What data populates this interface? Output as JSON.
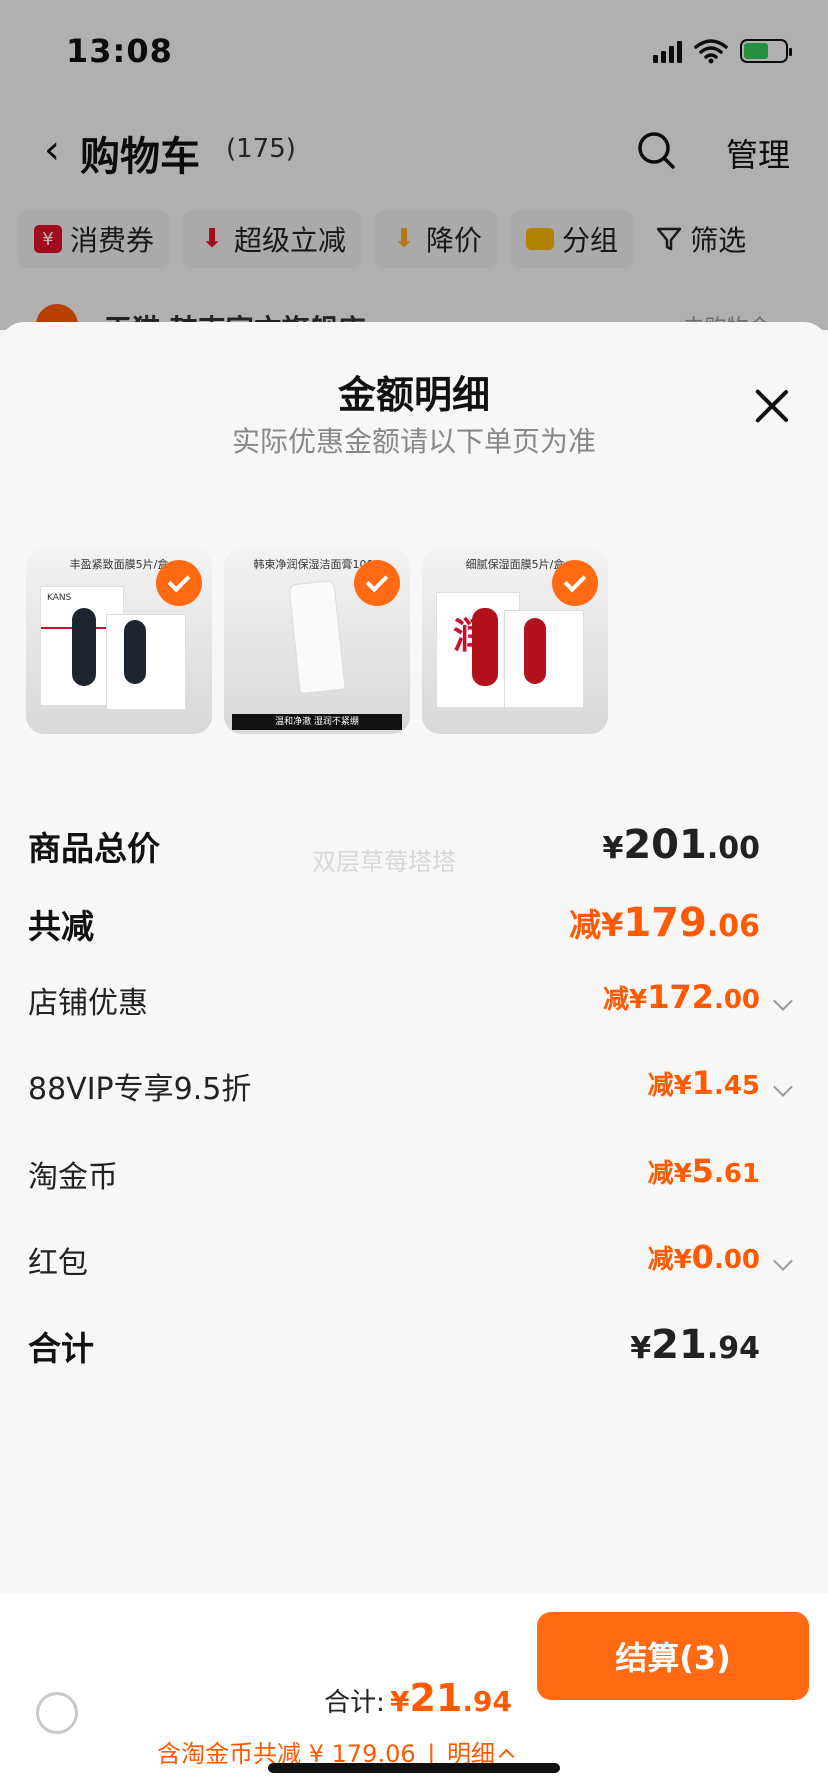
{
  "status_bar": {
    "time": "13:08"
  },
  "cart_header": {
    "title": "购物车",
    "count": "(175)",
    "manage": "管理"
  },
  "filters": [
    {
      "label": "消费券",
      "icon": "coupon-icon",
      "color": "#e0102a"
    },
    {
      "label": "超级立减",
      "icon": "arrow-down-icon",
      "color": "#e0102a"
    },
    {
      "label": "降价",
      "icon": "price-drop-icon",
      "color": "#f5a623"
    },
    {
      "label": "分组",
      "icon": "folder-icon",
      "color": "#f5b400"
    }
  ],
  "filter_plain": {
    "label": "筛选",
    "icon": "filter-icon"
  },
  "store_peek": {
    "name": "天猫 韩束官方旗舰店",
    "link": "去购物金 >"
  },
  "sheet": {
    "title": "金额明细",
    "subtitle": "实际优惠金额请以下单页为准",
    "watermark": "双层草莓塔塔"
  },
  "products": [
    {
      "caption": "丰盈紧致面膜5片/盒",
      "pkg_text": "KANS"
    },
    {
      "caption": "韩束净润保湿洁面膏100g",
      "band": "温和净澈 湿润不紧绷"
    },
    {
      "caption": "细腻保湿面膜5片/盒",
      "pkg_text": "润"
    }
  ],
  "breakdown": {
    "goods_total": {
      "label": "商品总价",
      "currency": "¥",
      "int": "201",
      "dec": ".00"
    },
    "total_discount": {
      "label": "共减",
      "prefix": "减¥",
      "int": "179",
      "dec": ".06"
    },
    "store_discount": {
      "label": "店铺优惠",
      "prefix": "减¥",
      "int": "172",
      "dec": ".00"
    },
    "vip_discount": {
      "label": "88VIP专享9.5折",
      "prefix": "减¥",
      "int": "1",
      "dec": ".45"
    },
    "coins": {
      "label": "淘金币",
      "prefix": "减¥",
      "int": "5",
      "dec": ".61"
    },
    "red_packet": {
      "label": "红包",
      "prefix": "减¥",
      "int": "0",
      "dec": ".00"
    },
    "sum": {
      "label": "合计",
      "currency": "¥",
      "int": "21",
      "dec": ".94"
    }
  },
  "bottom_bar": {
    "total_label": "合计:",
    "total_currency": "¥",
    "total_int": "21",
    "total_dec": ".94",
    "discount_text": "含淘金币共减 ¥ 179.06",
    "detail_label": "明细",
    "checkout_label": "结算(3)"
  },
  "colors": {
    "accent": "#ff5a00",
    "button": "#ff6a12"
  }
}
